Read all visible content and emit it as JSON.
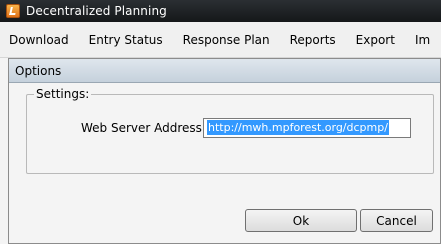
{
  "app": {
    "title": "Decentralized Planning",
    "icon": "app-logo-icon"
  },
  "menubar": {
    "items": [
      {
        "label": "Download"
      },
      {
        "label": "Entry Status"
      },
      {
        "label": "Response Plan"
      },
      {
        "label": "Reports"
      },
      {
        "label": "Export"
      },
      {
        "label": "Im"
      }
    ]
  },
  "dialog": {
    "title": "Options",
    "settings_legend": "Settings:",
    "web_server_label": "Web Server Address:",
    "web_server_value": "http://mwh.mpforest.org/dcpmp/",
    "ok_label": "Ok",
    "cancel_label": "Cancel"
  },
  "colors": {
    "titlebar": "#1f2225",
    "selection": "#3399ff",
    "dialog_titlebar": "#c9d4df"
  }
}
